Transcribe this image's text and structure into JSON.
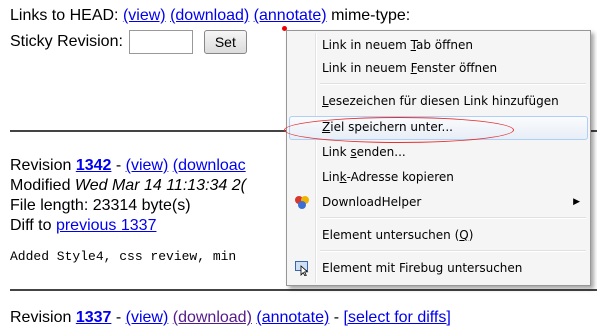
{
  "top": {
    "links_label": "Links to HEAD:",
    "view": "(view)",
    "download": "(download)",
    "annotate": "(annotate)",
    "mime": "mime-type:",
    "sticky_label": "Sticky Revision:",
    "sticky_value": "",
    "set_button": "Set"
  },
  "rev1342": {
    "prefix": "Revision ",
    "number": "1342",
    "sep": " - ",
    "view": "(view)",
    "download": "(downloac",
    "modified_prefix": "Modified ",
    "modified_date": "Wed Mar 14 11:13:34 2(",
    "file_length": "File length: 23314 byte(s)",
    "diff_prefix": "Diff to ",
    "diff_link": "previous 1337",
    "log": "Added Style4, css review, min"
  },
  "rev1337": {
    "prefix": "Revision ",
    "number": "1337",
    "sep": " - ",
    "view": "(view)",
    "download": "(download)",
    "annotate": "(annotate)",
    "dash": " - ",
    "select": "[select for diffs]"
  },
  "context_menu": {
    "items": [
      {
        "pre": "Link in neuem ",
        "key": "T",
        "post": "ab öffnen",
        "icon": ""
      },
      {
        "pre": "Link in neuem ",
        "key": "F",
        "post": "enster öffnen",
        "icon": ""
      },
      {
        "pre": "",
        "key": "L",
        "post": "esezeichen für diesen Link hinzufügen",
        "icon": ""
      },
      {
        "pre": "",
        "key": "Z",
        "post": "iel speichern unter...",
        "icon": ""
      },
      {
        "pre": "Link ",
        "key": "s",
        "post": "enden...",
        "icon": ""
      },
      {
        "pre": "Lin",
        "key": "k",
        "post": "-Adresse kopieren",
        "icon": ""
      },
      {
        "pre": "DownloadHelper",
        "key": "",
        "post": "",
        "icon": "downloadhelper-icon",
        "submenu": "▶"
      },
      {
        "pre": "Element untersuchen (",
        "key": "Q",
        "post": ")",
        "icon": ""
      },
      {
        "pre": "Element mit Firebug untersuchen",
        "key": "",
        "post": "",
        "icon": "firebug-inspect-icon"
      }
    ]
  },
  "colors": {
    "link": "#0000ee",
    "visited": "#551a8b",
    "highlight_border": "#aecff7",
    "annotation_red": "#e53030"
  }
}
